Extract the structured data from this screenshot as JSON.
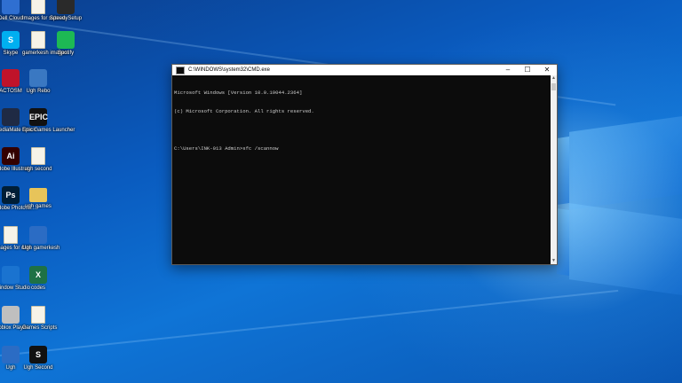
{
  "desktop": {
    "icons": [
      {
        "label": "Dell Cloud",
        "glyph": "",
        "kind": "app",
        "color": "#2f6fd1"
      },
      {
        "label": "Images for subrow",
        "glyph": "",
        "kind": "file"
      },
      {
        "label": "SpeedySetup",
        "glyph": "",
        "kind": "app",
        "color": "#2a2a2a"
      },
      {
        "label": "Skype",
        "glyph": "S",
        "kind": "app",
        "color": "#00aff0"
      },
      {
        "label": "gamerkesh images",
        "glyph": "",
        "kind": "file"
      },
      {
        "label": "Spotify",
        "glyph": "",
        "kind": "app",
        "color": "#1db954"
      },
      {
        "label": "ACTOSM",
        "glyph": "",
        "kind": "app",
        "color": "#c0132a"
      },
      {
        "label": "Ugh Rebo",
        "glyph": "",
        "kind": "app",
        "color": "#3a78c2"
      },
      {
        "label": "MediaMate Stock",
        "glyph": "",
        "kind": "app",
        "color": "#1f2a44"
      },
      {
        "label": "Epic Games Launcher",
        "glyph": "EPIC",
        "kind": "app",
        "color": "#111111"
      },
      {
        "label": "Adobe Illustrat...",
        "glyph": "Ai",
        "kind": "app",
        "color": "#330000"
      },
      {
        "label": "ugh second",
        "glyph": "",
        "kind": "file"
      },
      {
        "label": "Adobe Photosh...",
        "glyph": "Ps",
        "kind": "app",
        "color": "#001e36"
      },
      {
        "label": "ugh games",
        "glyph": "",
        "kind": "folder"
      },
      {
        "label": "Images for date",
        "glyph": "",
        "kind": "file"
      },
      {
        "label": "Ugh gamerkesh",
        "glyph": "",
        "kind": "app",
        "color": "#2b6cc4"
      },
      {
        "label": "Window Studio",
        "glyph": "",
        "kind": "app",
        "color": "#1a73d0"
      },
      {
        "label": "codes",
        "glyph": "X",
        "kind": "app",
        "color": "#1e7145"
      },
      {
        "label": "Roblox Player",
        "glyph": "",
        "kind": "app",
        "color": "#bfbfbf"
      },
      {
        "label": "Games Scripts",
        "glyph": "",
        "kind": "file"
      },
      {
        "label": "Ugh",
        "glyph": "",
        "kind": "app",
        "color": "#2b6cc4"
      },
      {
        "label": "Ugh Second",
        "glyph": "S",
        "kind": "app",
        "color": "#111111"
      }
    ]
  },
  "cmd": {
    "title": "C:\\WINDOWS\\system32\\CMD.exe",
    "minimize": "–",
    "maximize": "☐",
    "close": "✕",
    "lines": [
      "Microsoft Windows [Version 10.0.19044.2364]",
      "(c) Microsoft Corporation. All rights reserved.",
      "",
      "C:\\Users\\INK-013 Admin>sfc /scannow"
    ]
  }
}
